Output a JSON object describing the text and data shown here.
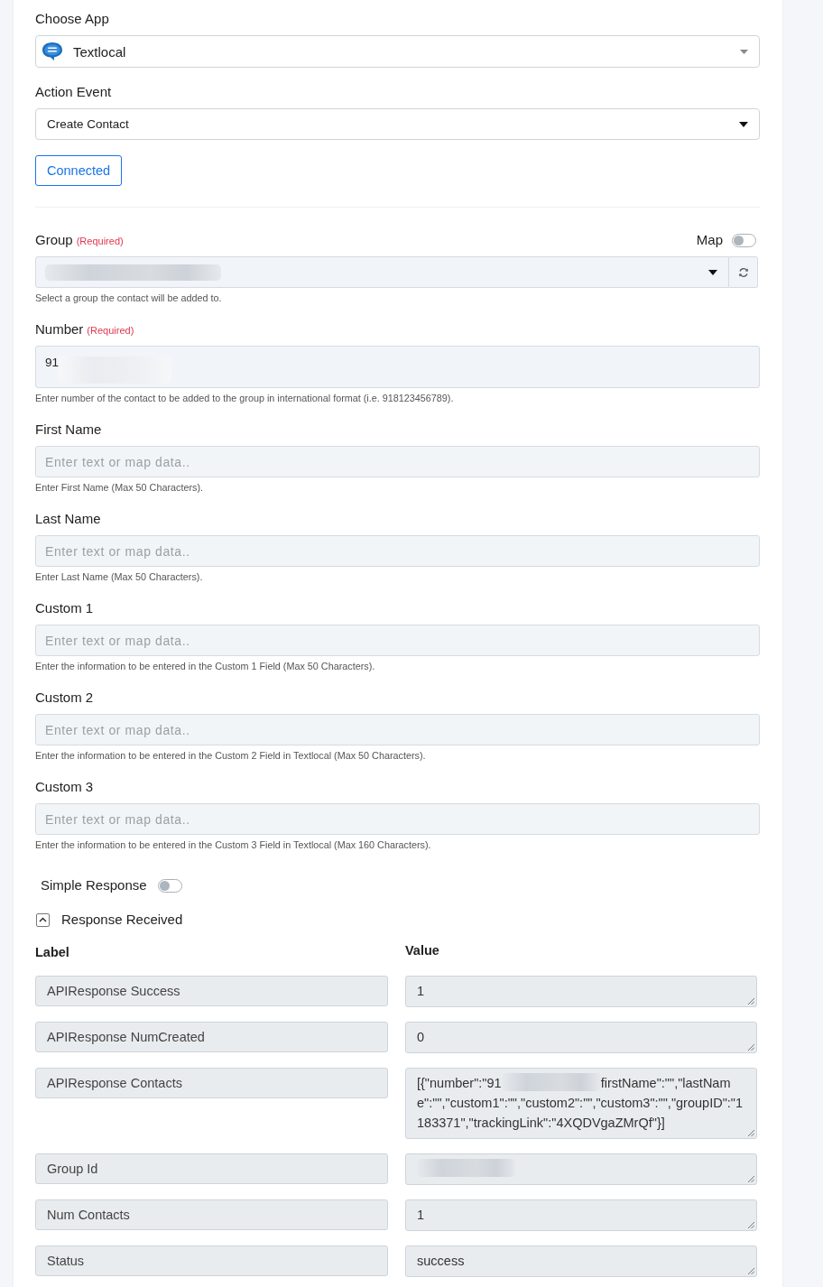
{
  "choose_app": {
    "label": "Choose App",
    "value": "Textlocal"
  },
  "action_event": {
    "label": "Action Event",
    "value": "Create Contact"
  },
  "connect_button": {
    "label": "Connected"
  },
  "fields": [
    {
      "kind": "select",
      "label": "Group",
      "required": "(Required)",
      "map_toggle": {
        "label": "Map",
        "on": false
      },
      "segments": [
        {
          "kind": "redacted"
        }
      ],
      "hint": "Select a group the contact will be added to."
    },
    {
      "kind": "textarea",
      "label": "Number",
      "required": "(Required)",
      "segments": [
        {
          "kind": "text",
          "text": "91"
        },
        {
          "kind": "redacted"
        }
      ],
      "hint": "Enter number of the contact to be added to the group in international format (i.e. 918123456789)."
    },
    {
      "kind": "text",
      "label": "First Name",
      "placeholder": "Enter text or map data..",
      "hint": "Enter First Name (Max 50 Characters)."
    },
    {
      "kind": "text",
      "label": "Last Name",
      "placeholder": "Enter text or map data..",
      "hint": "Enter Last Name (Max 50 Characters)."
    },
    {
      "kind": "text",
      "label": "Custom 1",
      "placeholder": "Enter text or map data..",
      "hint": "Enter the information to be entered in the Custom 1 Field (Max 50 Characters)."
    },
    {
      "kind": "text",
      "label": "Custom 2",
      "placeholder": "Enter text or map data..",
      "hint": "Enter the information to be entered in the Custom 2 Field in Textlocal (Max 50 Characters)."
    },
    {
      "kind": "text",
      "label": "Custom 3",
      "placeholder": "Enter text or map data..",
      "hint": "Enter the information to be entered in the Custom 3 Field in Textlocal (Max 160 Characters)."
    }
  ],
  "simple_response": {
    "label": "Simple Response",
    "on": false
  },
  "response": {
    "title": "Response Received",
    "expanded": true,
    "label_header": "Label",
    "value_header": "Value",
    "rows": [
      {
        "label": "APIResponse Success",
        "segments": [
          {
            "kind": "text",
            "text": "1"
          }
        ]
      },
      {
        "label": "APIResponse NumCreated",
        "segments": [
          {
            "kind": "text",
            "text": "0"
          }
        ]
      },
      {
        "label": "APIResponse Contacts",
        "segments": [
          {
            "kind": "text",
            "text": "[{\"number\":\"91"
          },
          {
            "kind": "redacted"
          },
          {
            "kind": "text",
            "text": "firstName\":\"\",\"lastName\":\"\",\"custom1\":\"\",\"custom2\":\"\",\"custom3\":\"\",\"groupID\":\"1183371\",\"trackingLink\":\"4XQDVgaZMrQf\"}]"
          }
        ]
      },
      {
        "label": "Group Id",
        "segments": [
          {
            "kind": "redacted"
          }
        ]
      },
      {
        "label": "Num Contacts",
        "segments": [
          {
            "kind": "text",
            "text": "1"
          }
        ]
      },
      {
        "label": "Status",
        "segments": [
          {
            "kind": "text",
            "text": "success"
          }
        ]
      }
    ]
  }
}
